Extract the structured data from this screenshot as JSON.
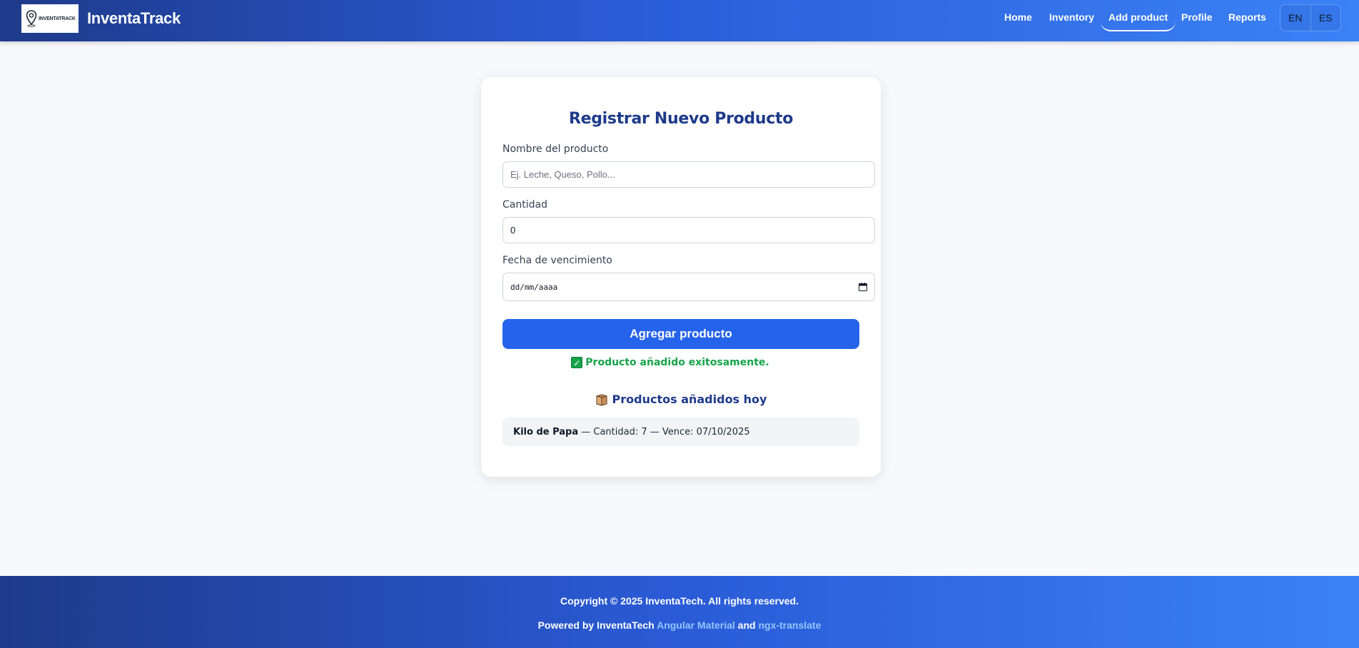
{
  "header": {
    "logo_text": "INVENTATRACK",
    "brand": "InventaTrack",
    "nav": [
      {
        "label": "Home",
        "active": false
      },
      {
        "label": "Inventory",
        "active": false
      },
      {
        "label": "Add product",
        "active": true
      },
      {
        "label": "Profile",
        "active": false
      },
      {
        "label": "Reports",
        "active": false
      }
    ],
    "languages": [
      "EN",
      "ES"
    ]
  },
  "form": {
    "title": "Registrar Nuevo Producto",
    "name_label": "Nombre del producto",
    "name_placeholder": "Ej. Leche, Queso, Pollo...",
    "name_value": "",
    "qty_label": "Cantidad",
    "qty_value": "0",
    "date_label": "Fecha de vencimiento",
    "date_placeholder": "dd/mm/aaaa",
    "submit_label": "Agregar producto",
    "success_message": "Producto añadido exitosamente."
  },
  "added_today": {
    "title": "Productos añadidos hoy",
    "items": [
      {
        "name": "Kilo de Papa",
        "details": " — Cantidad: 7 — Vence: 07/10/2025"
      }
    ]
  },
  "footer": {
    "copyright": "Copyright © 2025 InventaTech. All rights reserved.",
    "powered_prefix": "Powered by InventaTech ",
    "link1": "Angular Material",
    "and": " and ",
    "link2": "ngx-translate"
  },
  "colors": {
    "primary": "#2563eb",
    "brand_dark": "#1e3a8a",
    "success": "#16a34a"
  },
  "icons": {
    "logo": "location-pin-icon",
    "success": "checkmark-icon",
    "section": "box-icon",
    "date": "calendar-icon"
  }
}
